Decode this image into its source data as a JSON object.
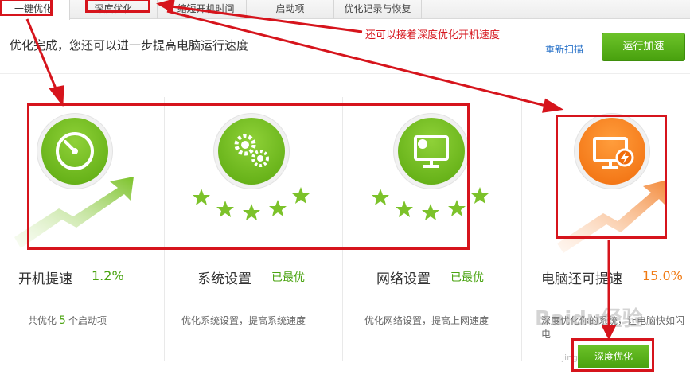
{
  "tabs": [
    {
      "label": "一键优化"
    },
    {
      "label": "深度优化"
    },
    {
      "label": "缩短开机时间"
    },
    {
      "label": "启动项"
    },
    {
      "label": "优化记录与恢复"
    }
  ],
  "header": {
    "status": "优化完成，您还可以进一步提高电脑运行速度",
    "rescan": "重新扫描",
    "run_button": "运行加速"
  },
  "annotation": {
    "text": "还可以接着深度优化开机速度"
  },
  "columns": [
    {
      "label": "开机提速",
      "value": "1.2%",
      "desc_prefix": "共优化",
      "desc_count": "5",
      "desc_suffix": "个启动项",
      "icon": "speedometer-icon"
    },
    {
      "label": "系统设置",
      "value": "已最优",
      "desc": "优化系统设置，提高系统速度",
      "stars": 5,
      "icon": "gears-icon"
    },
    {
      "label": "网络设置",
      "value": "已最优",
      "desc": "优化网络设置，提高上网速度",
      "stars": 5,
      "icon": "network-monitor-icon"
    },
    {
      "label": "电脑还可提速",
      "value": "15.0%",
      "desc": "深度优化你的系统，让电脑快如闪电",
      "icon": "monitor-lightning-icon"
    }
  ],
  "deep_button": "深度优化",
  "watermark": {
    "text": "Baidu经验",
    "sub": "jingyan.baidu.com"
  },
  "colors": {
    "green": "#5aa80f",
    "orange": "#f07a13",
    "annotation_red": "#d6141c",
    "link_blue": "#2a73c9"
  }
}
